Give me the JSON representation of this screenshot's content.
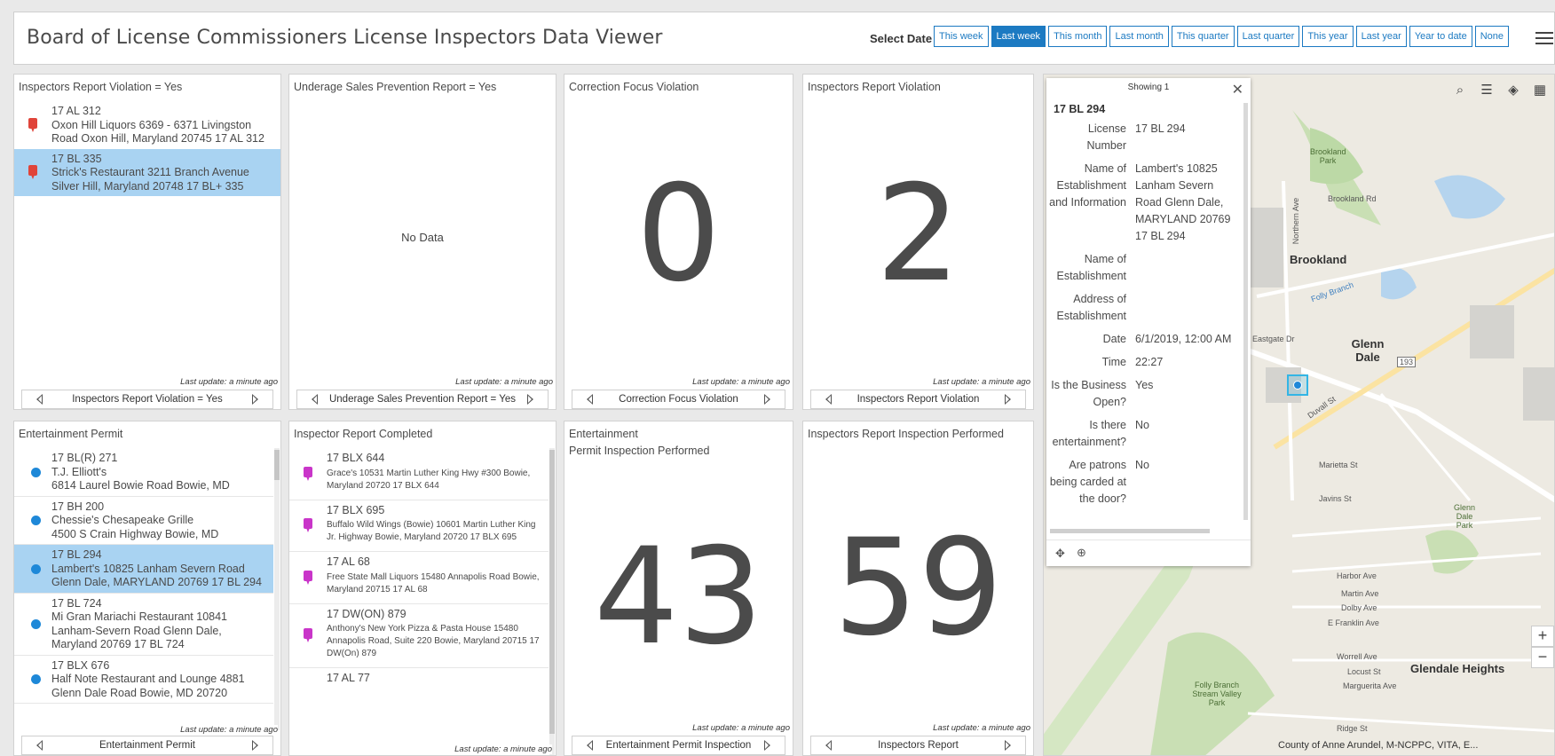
{
  "header": {
    "title": "Board of License Commissioners License Inspectors Data Viewer",
    "select_date_label": "Select Date",
    "date_buttons": [
      "This week",
      "Last week",
      "This month",
      "Last month",
      "This quarter",
      "Last quarter",
      "This year",
      "Last year",
      "Year to date",
      "None"
    ],
    "active_date_button": "Last week"
  },
  "panels": {
    "viol_yes": {
      "title": "Inspectors Report Violation = Yes",
      "items": [
        {
          "id": "17 AL 312",
          "text": "Oxon Hill Liquors 6369 - 6371 Livingston Road Oxon Hill, Maryland 20745 17 AL 312"
        },
        {
          "id": "17 BL 335",
          "text": "Strick's Restaurant 3211 Branch Avenue Silver Hill, Maryland 20748 17 BL+ 335"
        }
      ],
      "last_update": "Last update: a minute ago",
      "footer": "Inspectors Report Violation = Yes"
    },
    "underage": {
      "title": "Underage Sales Prevention Report = Yes",
      "empty_text": "No Data",
      "last_update": "Last update: a minute ago",
      "footer": "Underage Sales Prevention Report = Yes"
    },
    "correction": {
      "title": "Correction Focus Violation",
      "value": "0",
      "last_update": "Last update: a minute ago",
      "footer": "Correction Focus Violation"
    },
    "violation": {
      "title": "Inspectors Report Violation",
      "value": "2",
      "last_update": "Last update: a minute ago",
      "footer": "Inspectors Report Violation"
    },
    "entertainment_permit": {
      "title": "Entertainment Permit",
      "items": [
        {
          "id": "17 BL(R) 271",
          "line2": "T.J. Elliott's",
          "line3": "6814 Laurel Bowie Road Bowie, MD"
        },
        {
          "id": "17 BH 200",
          "line2": "Chessie's Chesapeake Grille",
          "line3": "4500 S Crain Highway Bowie, MD"
        },
        {
          "id": "17 BL 294",
          "line2": "Lambert's 10825 Lanham Severn Road Glenn Dale, MARYLAND 20769 17 BL 294",
          "line3": ""
        },
        {
          "id": "17 BL 724",
          "line2": "Mi Gran Mariachi Restaurant 10841 Lanham-Severn Road Glenn Dale, Maryland 20769 17 BL 724",
          "line3": ""
        },
        {
          "id": "17 BLX 676",
          "line2": "Half Note Restaurant and Lounge 4881 Glenn Dale Road Bowie, MD 20720",
          "line3": ""
        }
      ],
      "last_update": "Last update: a minute ago",
      "footer": "Entertainment Permit"
    },
    "completed": {
      "title": "Inspector Report Completed",
      "items": [
        {
          "id": "17 BLX 644",
          "text": "Grace's 10531 Martin Luther King Hwy #300 Bowie, Maryland 20720 17 BLX 644"
        },
        {
          "id": "17 BLX 695",
          "text": "Buffalo Wild Wings (Bowie) 10601 Martin Luther King Jr. Highway Bowie, Maryland 20720 17 BLX 695"
        },
        {
          "id": "17 AL 68",
          "text": "Free State Mall Liquors 15480 Annapolis Road Bowie, Maryland 20715 17 AL 68"
        },
        {
          "id": "17 DW(ON) 879",
          "text": "Anthony's New York Pizza & Pasta House 15480 Annapolis Road, Suite 220 Bowie, Maryland 20715 17 DW(On) 879"
        },
        {
          "id": "17 AL 77",
          "text": ""
        }
      ],
      "last_update": "Last update: a minute ago"
    },
    "ent_inspection": {
      "title": "Entertainment",
      "title2": "Permit Inspection Performed",
      "value": "43",
      "last_update": "Last update: a minute ago",
      "footer": "Entertainment Permit Inspection"
    },
    "inspection_performed": {
      "title": "Inspectors Report Inspection Performed",
      "value": "59",
      "last_update": "Last update: a minute ago",
      "footer": "Inspectors Report"
    }
  },
  "popup": {
    "showing": "Showing 1",
    "title": "17 BL 294",
    "attributes": [
      {
        "k": "License Number",
        "v": "17 BL 294"
      },
      {
        "k": "Name of Establishment and Information",
        "v": "Lambert's 10825 Lanham Severn Road Glenn Dale, MARYLAND 20769 17 BL 294"
      },
      {
        "k": "Name of Establishment",
        "v": ""
      },
      {
        "k": "Address of Establishment",
        "v": ""
      },
      {
        "k": "Date",
        "v": "6/1/2019, 12:00 AM"
      },
      {
        "k": "Time",
        "v": "22:27"
      },
      {
        "k": "Is the Business Open?",
        "v": "Yes"
      },
      {
        "k": "Is there entertainment?",
        "v": "No"
      },
      {
        "k": "Are patrons being carded at the door?",
        "v": "No"
      }
    ]
  },
  "map": {
    "labels": {
      "brookland": "Brookland",
      "glenn_dale": "Glenn Dale",
      "glendale_heights": "Glendale Heights",
      "brookland_park": "Brookland Park",
      "glenn_dale_park": "Glenn Dale Park",
      "folly_branch_park": "Folly Branch Stream Valley Park",
      "harbor_ave": "Harbor Ave",
      "martin_ave": "Martin Ave",
      "dolby_ave": "Dolby Ave",
      "franklin_ave": "E Franklin Ave",
      "worrell_ave": "Worrell Ave",
      "locust_st": "Locust St",
      "marguerita_ave": "Marguerita Ave",
      "ridge_st": "Ridge St",
      "javins_st": "Javins St",
      "marietta_st": "Marietta St",
      "duvall_st": "Duvall St",
      "brookland_rd": "Brookland Rd",
      "northern_ave": "Northern Ave",
      "eastgate_dr": "Eastgate Dr",
      "folly_branch": "Folly Branch",
      "route_193": "193"
    },
    "attribution": "County of Anne Arundel, M-NCPPC, VITA, E...",
    "zoom_in": "+",
    "zoom_out": "−"
  },
  "colors": {
    "accent": "#1c7ac2",
    "selected_row": "#a9d3f2",
    "pin_red": "#e0443a",
    "pin_magenta": "#c935c9",
    "dot_blue": "#1e88d8"
  }
}
